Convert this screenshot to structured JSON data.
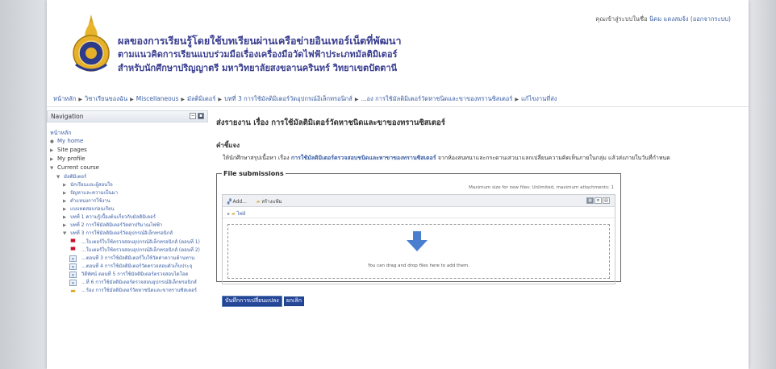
{
  "header": {
    "title_lines": [
      "ผลของการเรียนรู้โดยใช้บทเรียนผ่านเครือข่ายอินเทอร์เน็ตที่พัฒนา",
      "ตามแนวคิดการเรียนแบบร่วมมือเรื่องเครื่องมือวัดไฟฟ้าประเภทมัลติมิเตอร์",
      "สำหรับนักศึกษาปริญญาตรี มหาวิทยาลัยสงขลานครินทร์ วิทยาเขตปัตตานี"
    ],
    "login_prefix": "คุณเข้าสู่ระบบในชื่อ",
    "user_name": "นิคม แดงสมจ้ง",
    "logout_label": "(ออกจากระบบ)"
  },
  "breadcrumb": [
    "หน้าหลัก",
    "วิชาเรียนของฉัน",
    "Miscellaneous",
    "มัลติมิเตอร์",
    "บทที่ 3 การใช้มัลติมิเตอร์วัดอุปกรณ์อิเล็กทรอนิกส์",
    "...อง การใช้มัลติมิเตอร์วัดหาชนิดและขาของทรานซิสเตอร์",
    "แก้ไขงานที่ส่ง"
  ],
  "navigation": {
    "title": "Navigation",
    "home": "หน้าหลัก",
    "items": [
      "My home",
      "Site pages",
      "My profile",
      "Current course"
    ],
    "course_name": "มัลติมิเตอร์",
    "sections": [
      "นักเรียนและผู้สอนใจ",
      "ปัญหาและความเป็นมา",
      "ตำแหน่งการใช้งาน",
      "แบบทดสอบก่อนเรียน",
      "บทที่ 1 ความรู้เบื้องต้นเกี่ยวกับมัลติมิเตอร์",
      "บทที่ 2 การใช้มัลติมิเตอร์วัดค่าปริมาณไฟฟ้า",
      "บทที่ 3 การใช้มัลติมิเตอร์วัดอุปกรณ์อิเล็กทรอนิกส์"
    ],
    "resources": [
      {
        "label": "...ใบเตอร์ใบใช้ตรวจสอบอุปกรณ์อิเล็กทรอนิกส์ (ตอนที่ 1)",
        "icon": "pdf-icon"
      },
      {
        "label": "...ใบเตอร์ใบใช้ตรวจสอบอุปกรณ์อิเล็กทรอนิกส์ (ตอนที่ 2)",
        "icon": "pdf-icon"
      },
      {
        "label": "...ตอนที่ 3 การใช้มัลติมิเตอร์ใบใช้วัดค่าความต้านทาน",
        "icon": "page-icon"
      },
      {
        "label": "...ตอนที่ 4 การใช้มัลติมิเตอร์วัดตรวจสอบตัวเก็บประจุ",
        "icon": "page-icon"
      },
      {
        "label": "วิดีทัศน์ ตอนที่ 5 การใช้มัลติมิเตอร์ตรวจสอบไดโอด",
        "icon": "page-icon"
      },
      {
        "label": "...ที่ 6 การใช้มัลติมิเตอร์ตรวจสอบอุปกรณ์อิเล็กทรอนิกส์",
        "icon": "page-icon"
      },
      {
        "label": "...ร้อง การใช้มัลติมิเตอร์วัดหาชนิดและขาทรานซิสเตอร์",
        "icon": "assignment-icon"
      }
    ]
  },
  "main": {
    "heading": "ส่งรายงาน เรื่อง การใช้มัลติมิเตอร์วัดหาชนิดและขาของทรานซิสเตอร์",
    "instruction_heading": "คำชี้แจง",
    "instruction_pre": "ให้นักศึกษาสรุปเนื้อหา เรื่อง",
    "instruction_bold": "การใช้มัลติมิเตอร์ตรวจสอบชนิดและหาขาของทรานซิสเตอร์",
    "instruction_post": "จากห้องสนทนาและกระดานเสวนาแลกเปลี่ยนความคิดเห็นภายในกลุ่ม แล้วส่งภายในวันที่กำหนด",
    "file_submissions_label": "File submissions",
    "max_size_text": "Maximum size for new files: Unlimited, maximum attachments: 1",
    "add_label": "Add...",
    "create_folder_label": "สร้างแฟ้ม",
    "path_label": "ไฟล์",
    "drop_text": "You can drag and drop files here to add them.",
    "save_button": "บันทึกการเปลี่ยนแปลง",
    "cancel_button": "ยกเลิก"
  },
  "colors": {
    "title": "#3a3e8f",
    "link": "#3b5fa5",
    "button": "#27489a",
    "drop_arrow": "#4a7fd0"
  }
}
